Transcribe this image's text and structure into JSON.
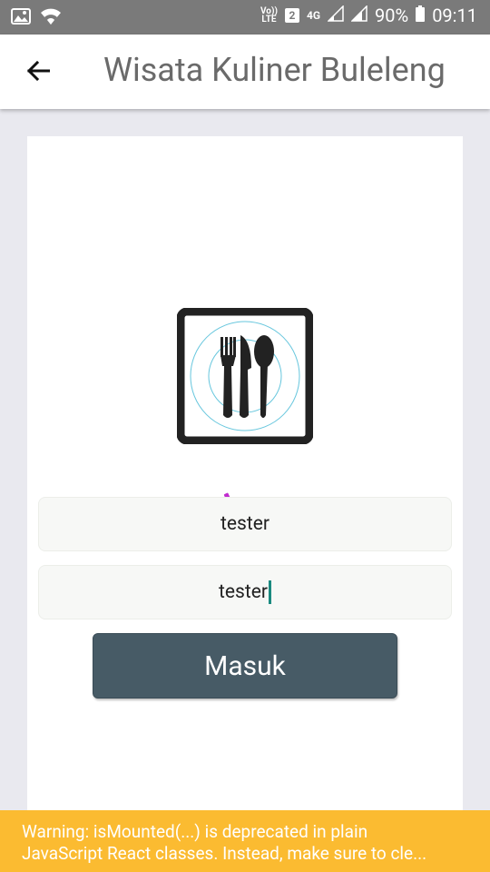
{
  "status_bar": {
    "volte_top": "Vo))",
    "volte_bottom": "LTE",
    "sim_slot": "2",
    "network": "4G",
    "battery": "90%",
    "time": "09:11"
  },
  "app_bar": {
    "title": "Wisata Kuliner Buleleng"
  },
  "form": {
    "username_value": "tester",
    "password_value": "tester",
    "login_label": "Masuk"
  },
  "warning": {
    "line1": "Warning: isMounted(...) is deprecated in plain",
    "line2": "JavaScript React classes. Instead, make sure to cle..."
  },
  "colors": {
    "status_bar": "#7a7a7a",
    "button": "#475b66",
    "warning": "#fbbb31",
    "caret": "#1a8a80"
  }
}
